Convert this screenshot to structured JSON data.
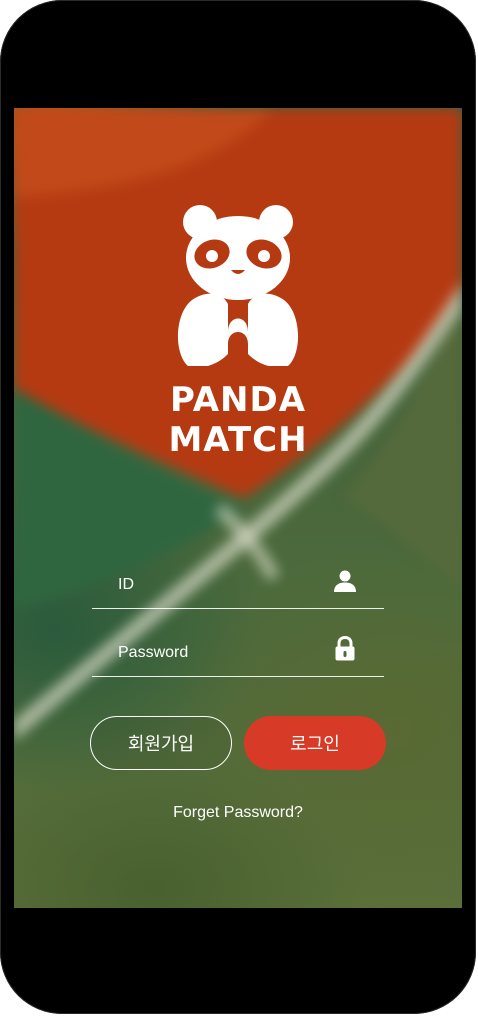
{
  "brand": {
    "line1": "PANDA",
    "line2": "MATCH",
    "logo_icon": "panda-icon"
  },
  "login_form": {
    "id_placeholder": "ID",
    "id_value": "",
    "id_icon": "user-icon",
    "password_placeholder": "Password",
    "password_value": "",
    "password_icon": "lock-icon"
  },
  "buttons": {
    "signup_label": "회원가입",
    "login_label": "로그인"
  },
  "links": {
    "forgot_password": "Forget Password?"
  },
  "colors": {
    "accent": "#d73a27",
    "text": "#ffffff",
    "frame": "#000000"
  }
}
